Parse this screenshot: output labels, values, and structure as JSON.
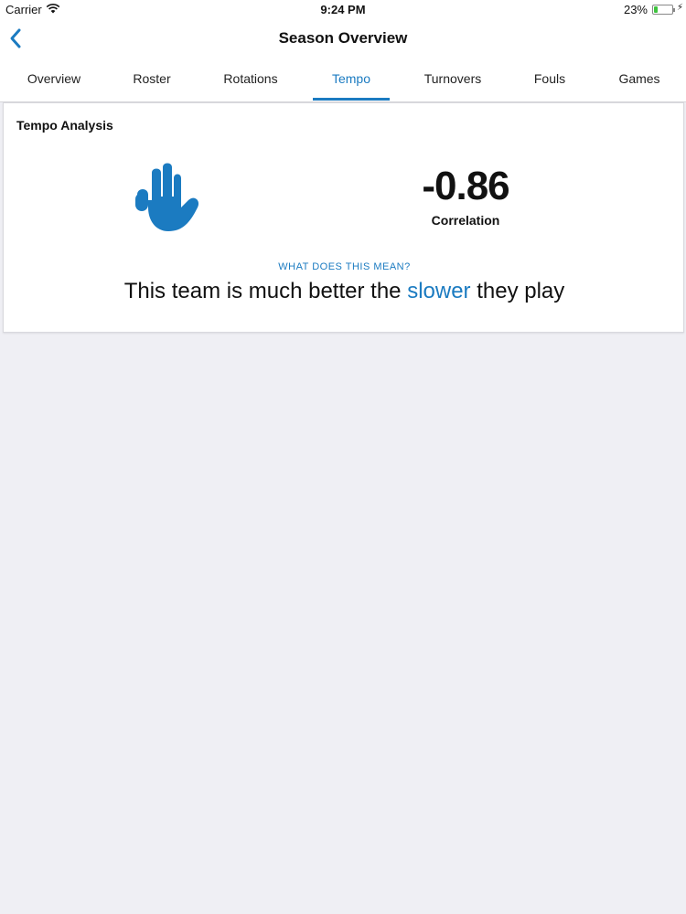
{
  "status_bar": {
    "carrier": "Carrier",
    "time": "9:24 PM",
    "battery_percent": "23%",
    "battery_level": 0.23,
    "icons": [
      "wifi-icon",
      "battery-icon",
      "charging-bolt-icon"
    ]
  },
  "nav": {
    "back_icon": "chevron-left-icon",
    "title": "Season Overview"
  },
  "tabs": [
    {
      "label": "Overview",
      "active": false
    },
    {
      "label": "Roster",
      "active": false
    },
    {
      "label": "Rotations",
      "active": false
    },
    {
      "label": "Tempo",
      "active": true
    },
    {
      "label": "Turnovers",
      "active": false
    },
    {
      "label": "Fouls",
      "active": false
    },
    {
      "label": "Games",
      "active": false
    }
  ],
  "tempo_card": {
    "title": "Tempo Analysis",
    "icon": "hand-stop-icon",
    "correlation_value": "-0.86",
    "correlation_label": "Correlation",
    "question_link": "WHAT DOES THIS MEAN?",
    "sentence": {
      "before": "This team is much better the ",
      "highlight": "slower",
      "after": " they play"
    }
  },
  "colors": {
    "accent": "#1b7bc1",
    "background": "#efeff4",
    "card": "#ffffff"
  }
}
